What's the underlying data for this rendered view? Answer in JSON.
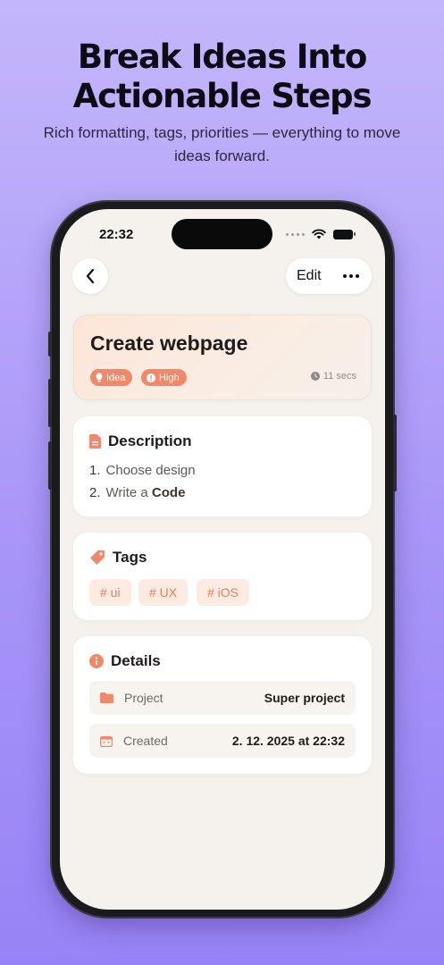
{
  "promo": {
    "headline_line1": "Break Ideas Into",
    "headline_line2": "Actionable Steps",
    "subline": "Rich formatting, tags, priorities — everything to move ideas forward."
  },
  "status_bar": {
    "time": "22:32"
  },
  "nav": {
    "edit_label": "Edit",
    "back_icon": "chevron-left-icon",
    "more_icon": "ellipsis-icon"
  },
  "task": {
    "title": "Create webpage",
    "type_chip": "Idea",
    "priority_chip": "High",
    "elapsed": "11 secs"
  },
  "description": {
    "heading": "Description",
    "items": [
      {
        "num": "1.",
        "text": "Choose design",
        "bold": ""
      },
      {
        "num": "2.",
        "text": "Write a ",
        "bold": "Code"
      }
    ]
  },
  "tags": {
    "heading": "Tags",
    "items": [
      "# ui",
      "# UX",
      "# iOS"
    ]
  },
  "details": {
    "heading": "Details",
    "project_label": "Project",
    "project_value": "Super project",
    "created_label": "Created",
    "created_value": "2. 12. 2025 at 22:32"
  },
  "colors": {
    "accent": "#f0896a",
    "tag_bg": "#fdebe2",
    "screen_bg": "#f5f2ee"
  }
}
